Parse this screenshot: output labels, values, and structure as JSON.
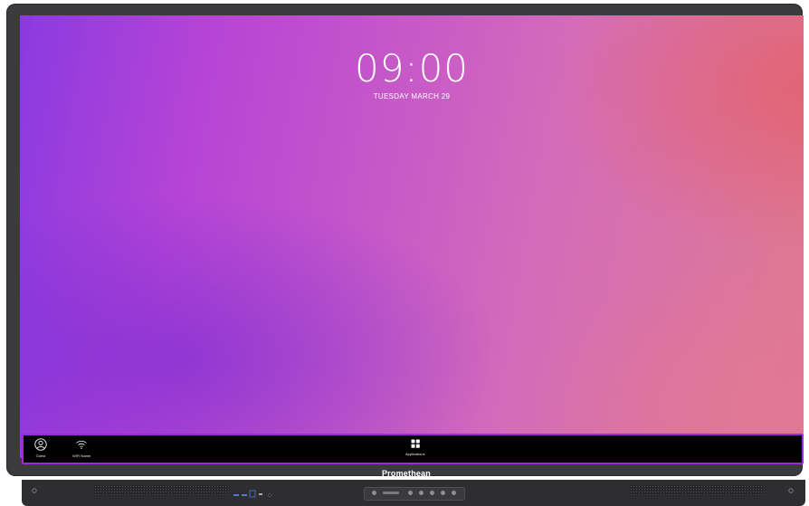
{
  "screen": {
    "time": "09:00",
    "date": "TUESDAY MARCH 29"
  },
  "taskbar": {
    "guest_label": "Guest",
    "wifi_label": "WIFI Name",
    "apps_label": "Applications"
  },
  "device": {
    "brand": "Promethean"
  },
  "colors": {
    "taskbar_border": "#9b2ad8",
    "bezel": "#3b3b3d"
  }
}
